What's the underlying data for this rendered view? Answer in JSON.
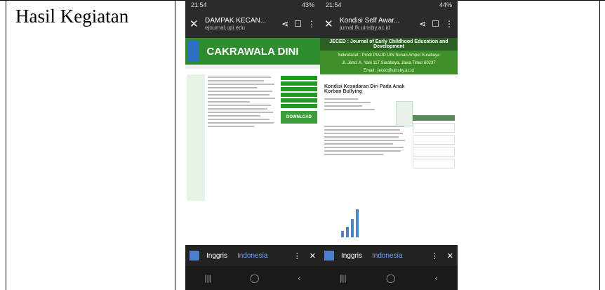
{
  "label": "Hasil Kegiatan",
  "phone1": {
    "status_time": "21:54",
    "status_right": "43%",
    "title": "DAMPAK KECAN...",
    "url": "ejournal.upi.edu",
    "banner_title": "CAKRAWALA DINI",
    "download_label": "DOWNLOAD",
    "translate_lang1": "Inggris",
    "translate_lang2": "Indonesia"
  },
  "phone2": {
    "status_time": "21:54",
    "status_right": "44%",
    "title": "Kondisi Self Awar...",
    "url": "jurnal.fk.uinsby.ac.id",
    "banner_title": "JECED : Journal of Early Childhood Education and Development",
    "banner_line1": "Sekretariat : Prodi PIAUD UIN Sunan Ampel Surabaya",
    "banner_line2": "Jl. Jend. A. Yani 117 Surabaya, Jawa Timur 60237",
    "banner_line3": "Email : jeced@uinsby.ac.id",
    "article_title": "Kondisi Kesadaran Diri Pada Anak Korban Bullying",
    "translate_lang1": "Inggris",
    "translate_lang2": "Indonesia"
  },
  "bar_values": [
    0.2,
    0.35,
    0.6,
    0.9
  ]
}
